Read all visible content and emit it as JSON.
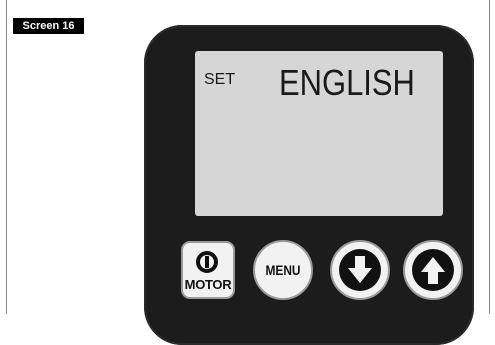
{
  "screen_label": "Screen 16",
  "lcd": {
    "mode": "SET",
    "value": "ENGLISH"
  },
  "buttons": {
    "motor_label": "MOTOR",
    "menu_label": "MENU"
  },
  "icons": {
    "motor": "power-icon",
    "down": "arrow-down-icon",
    "up": "arrow-up-icon"
  },
  "colors": {
    "device_body": "#1c1c1c",
    "lcd_background": "#d6d6d6",
    "button_face": "#f2f2f2"
  }
}
